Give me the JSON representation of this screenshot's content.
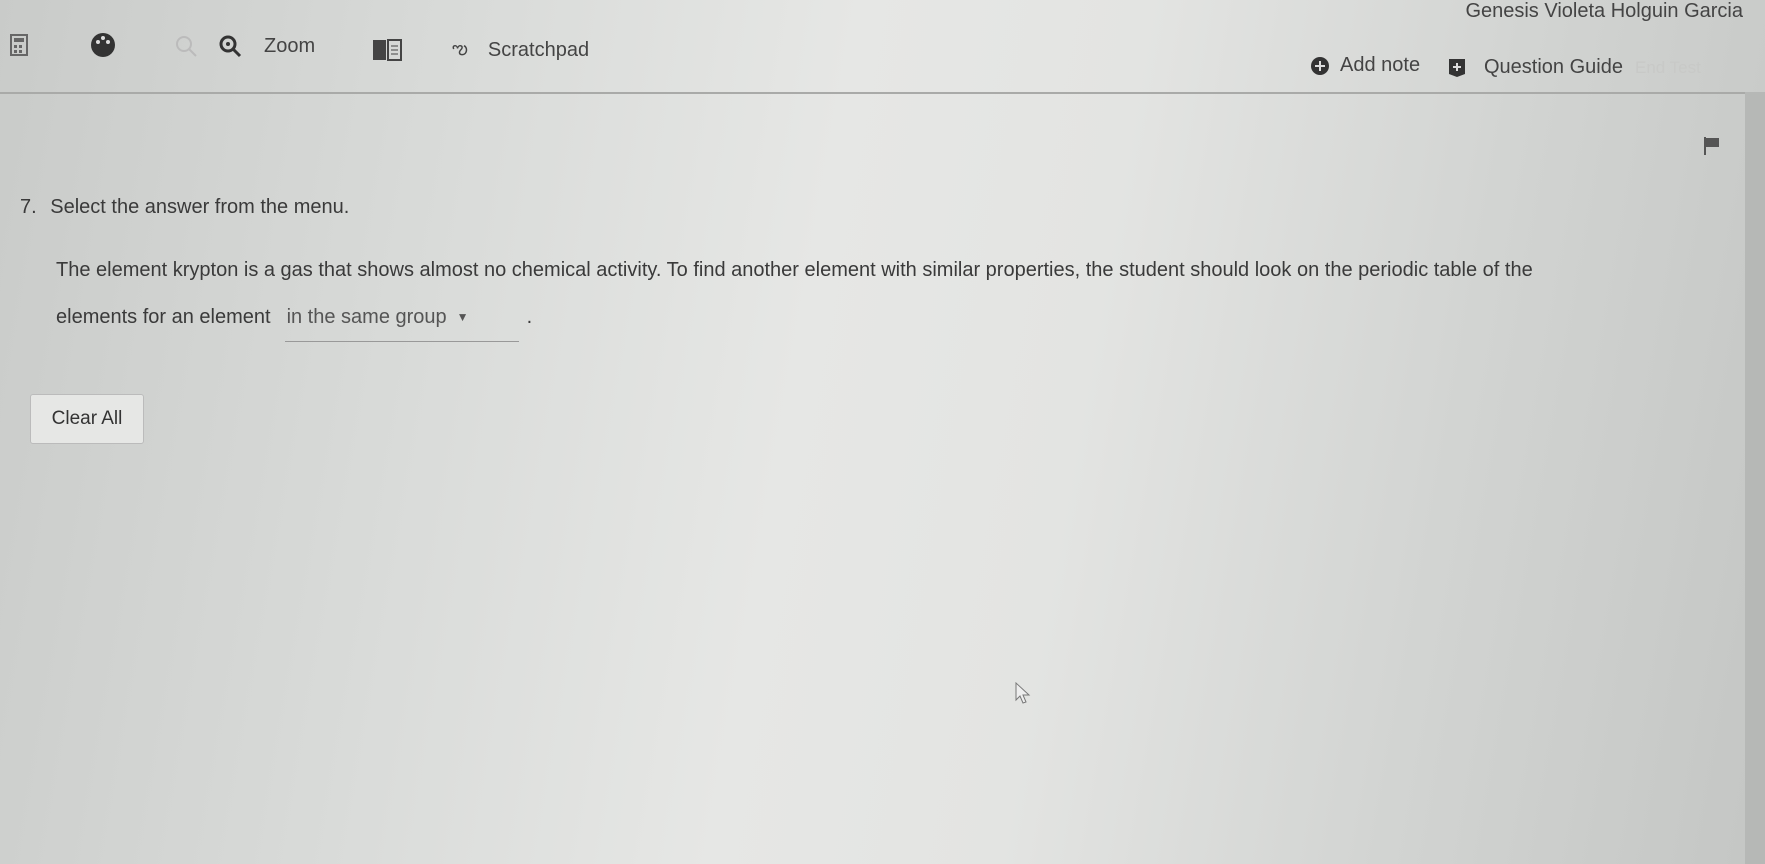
{
  "header": {
    "user_name": "Genesis Violeta Holguin Garcia",
    "tools": [
      {
        "icon": "calculator-icon"
      },
      {
        "icon": "palette-icon"
      },
      {
        "icon": "zoom-out-icon"
      },
      {
        "icon": "zoom-in-icon",
        "label": "Zoom"
      },
      {
        "icon": "reference-book-icon"
      },
      {
        "icon": "scratchpad-icon",
        "label": "Scratchpad"
      }
    ],
    "add_note": "Add note",
    "question_guide": "Question Guide",
    "end_test": "End Test"
  },
  "question": {
    "number": "7.",
    "prompt": "Select the answer from the menu.",
    "text_line1": "The element krypton is a gas that shows almost no chemical activity. To find another element with similar properties, the student should look on the periodic table of the",
    "text_line2": "elements for an element",
    "selected_answer": "in the same group",
    "after": "."
  },
  "clear_all": "Clear All"
}
